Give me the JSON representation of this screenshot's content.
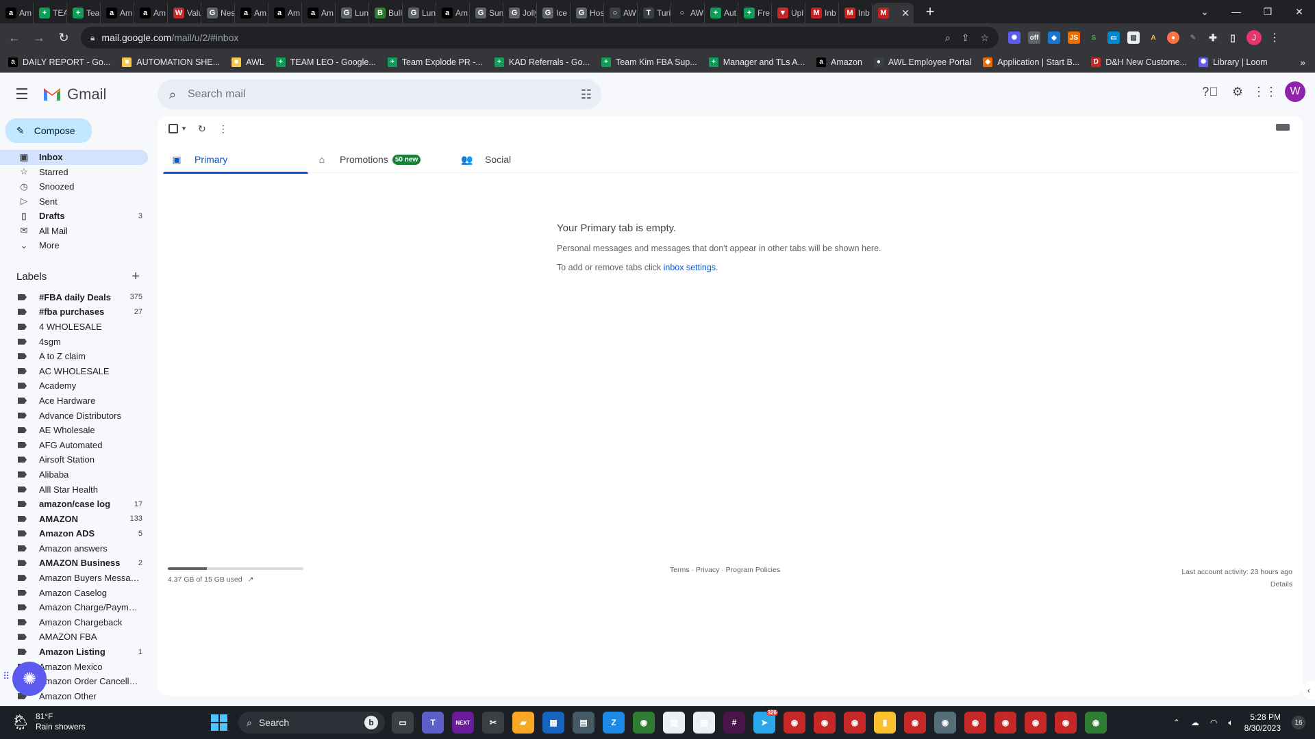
{
  "browser": {
    "tabs": [
      {
        "label": "Am",
        "icon": "a",
        "color": "#000000"
      },
      {
        "label": "TEA",
        "icon": "+",
        "color": "#0f9d58"
      },
      {
        "label": "Tea",
        "icon": "+",
        "color": "#0f9d58"
      },
      {
        "label": "Am",
        "icon": "a",
        "color": "#000000"
      },
      {
        "label": "Am",
        "icon": "a",
        "color": "#000000"
      },
      {
        "label": "Valu",
        "icon": "W",
        "color": "#c62828"
      },
      {
        "label": "Nes",
        "icon": "G",
        "color": "#5f6368"
      },
      {
        "label": "Am",
        "icon": "a",
        "color": "#000000"
      },
      {
        "label": "Am",
        "icon": "a",
        "color": "#000000"
      },
      {
        "label": "Am",
        "icon": "a",
        "color": "#000000"
      },
      {
        "label": "Lun",
        "icon": "G",
        "color": "#5f6368"
      },
      {
        "label": "Bull",
        "icon": "B",
        "color": "#2e7d32"
      },
      {
        "label": "Lun",
        "icon": "G",
        "color": "#5f6368"
      },
      {
        "label": "Am",
        "icon": "a",
        "color": "#000000"
      },
      {
        "label": "Sun",
        "icon": "G",
        "color": "#5f6368"
      },
      {
        "label": "Jolly",
        "icon": "G",
        "color": "#5f6368"
      },
      {
        "label": "Ice I",
        "icon": "G",
        "color": "#5f6368"
      },
      {
        "label": "Hos",
        "icon": "G",
        "color": "#5f6368"
      },
      {
        "label": "AWI",
        "icon": "○",
        "color": "#3c4043"
      },
      {
        "label": "Turi",
        "icon": "T",
        "color": "#3c4043"
      },
      {
        "label": "AWI",
        "icon": "○",
        "color": "#202124"
      },
      {
        "label": "Aut",
        "icon": "+",
        "color": "#0f9d58"
      },
      {
        "label": "Fre",
        "icon": "+",
        "color": "#0f9d58"
      },
      {
        "label": "Upl",
        "icon": "▼",
        "color": "#c62828"
      },
      {
        "label": "Inb",
        "icon": "M",
        "color": "#c5221f"
      },
      {
        "label": "Inb",
        "icon": "M",
        "color": "#c5221f"
      }
    ],
    "active_tab": {
      "label": "",
      "icon": "M",
      "color": "#c5221f"
    },
    "url_host": "mail.google.com",
    "url_path": "/mail/u/2/#inbox",
    "profile_initial": "J",
    "bookmarks": [
      {
        "label": "DAILY REPORT - Go...",
        "icon": "a",
        "color": "#000000"
      },
      {
        "label": "AUTOMATION SHE...",
        "icon": "■",
        "color": "#f9c74f"
      },
      {
        "label": "AWL",
        "icon": "■",
        "color": "#f9c74f"
      },
      {
        "label": "TEAM LEO - Google...",
        "icon": "+",
        "color": "#0f9d58"
      },
      {
        "label": "Team Explode PR -...",
        "icon": "+",
        "color": "#0f9d58"
      },
      {
        "label": "KAD Referrals - Go...",
        "icon": "+",
        "color": "#0f9d58"
      },
      {
        "label": "Team Kim FBA Sup...",
        "icon": "+",
        "color": "#0f9d58"
      },
      {
        "label": "Manager and TLs A...",
        "icon": "+",
        "color": "#0f9d58"
      },
      {
        "label": "Amazon",
        "icon": "a",
        "color": "#000000"
      },
      {
        "label": "AWL Employee Portal",
        "icon": "●",
        "color": "#3c4043"
      },
      {
        "label": "Application | Start B...",
        "icon": "◆",
        "color": "#ef6c00"
      },
      {
        "label": "D&H New Custome...",
        "icon": "D",
        "color": "#c62828"
      },
      {
        "label": "Library | Loom",
        "icon": "✺",
        "color": "#625df5"
      }
    ]
  },
  "gmail": {
    "product_name": "Gmail",
    "search_placeholder": "Search mail",
    "avatar_initial": "W",
    "compose_label": "Compose",
    "nav": [
      {
        "label": "Inbox",
        "icon": "▣",
        "count": "",
        "active": true,
        "bold": true
      },
      {
        "label": "Starred",
        "icon": "☆",
        "count": "",
        "active": false,
        "bold": false
      },
      {
        "label": "Snoozed",
        "icon": "◷",
        "count": "",
        "active": false,
        "bold": false
      },
      {
        "label": "Sent",
        "icon": "▷",
        "count": "",
        "active": false,
        "bold": false
      },
      {
        "label": "Drafts",
        "icon": "▯",
        "count": "3",
        "active": false,
        "bold": true
      },
      {
        "label": "All Mail",
        "icon": "✉",
        "count": "",
        "active": false,
        "bold": false
      },
      {
        "label": "More",
        "icon": "⌄",
        "count": "",
        "active": false,
        "bold": false
      }
    ],
    "labels_title": "Labels",
    "labels": [
      {
        "name": "#FBA daily Deals",
        "count": "375",
        "bold": true
      },
      {
        "name": "#fba purchases",
        "count": "27",
        "bold": true
      },
      {
        "name": "4 WHOLESALE",
        "count": "",
        "bold": false
      },
      {
        "name": "4sgm",
        "count": "",
        "bold": false
      },
      {
        "name": "A to Z claim",
        "count": "",
        "bold": false
      },
      {
        "name": "AC WHOLESALE",
        "count": "",
        "bold": false
      },
      {
        "name": "Academy",
        "count": "",
        "bold": false
      },
      {
        "name": "Ace Hardware",
        "count": "",
        "bold": false
      },
      {
        "name": "Advance Distributors",
        "count": "",
        "bold": false
      },
      {
        "name": "AE Wholesale",
        "count": "",
        "bold": false
      },
      {
        "name": "AFG Automated",
        "count": "",
        "bold": false
      },
      {
        "name": "Airsoft Station",
        "count": "",
        "bold": false
      },
      {
        "name": "Alibaba",
        "count": "",
        "bold": false
      },
      {
        "name": "Alll Star Health",
        "count": "",
        "bold": false
      },
      {
        "name": "amazon/case log",
        "count": "17",
        "bold": true
      },
      {
        "name": "AMAZON",
        "count": "133",
        "bold": true
      },
      {
        "name": "Amazon ADS",
        "count": "5",
        "bold": true
      },
      {
        "name": "Amazon answers",
        "count": "",
        "bold": false
      },
      {
        "name": "AMAZON Business",
        "count": "2",
        "bold": true
      },
      {
        "name": "Amazon Buyers Messages",
        "count": "",
        "bold": false
      },
      {
        "name": "Amazon Caselog",
        "count": "",
        "bold": false
      },
      {
        "name": "Amazon Charge/Paymen...",
        "count": "",
        "bold": false
      },
      {
        "name": "Amazon Chargeback",
        "count": "",
        "bold": false
      },
      {
        "name": "AMAZON FBA",
        "count": "",
        "bold": false
      },
      {
        "name": "Amazon Listing",
        "count": "1",
        "bold": true
      },
      {
        "name": "Amazon Mexico",
        "count": "",
        "bold": false
      },
      {
        "name": "Amazon Order Cancellat...",
        "count": "",
        "bold": false
      },
      {
        "name": "Amazon Other",
        "count": "",
        "bold": false
      }
    ],
    "tabs": [
      {
        "label": "Primary",
        "icon": "▣",
        "badge": "",
        "active": true
      },
      {
        "label": "Promotions",
        "icon": "⌂",
        "badge": "50 new",
        "active": false
      },
      {
        "label": "Social",
        "icon": "👥",
        "badge": "",
        "active": false
      }
    ],
    "empty_title": "Your Primary tab is empty.",
    "empty_desc": "Personal messages and messages that don't appear in other tabs will be shown here.",
    "empty_tabs_prefix": "To add or remove tabs click ",
    "empty_tabs_link": "inbox settings",
    "empty_tabs_suffix": ".",
    "storage_text": "4.37 GB of 15 GB used",
    "storage_fraction": 0.29,
    "footer_links": "Terms · Privacy · Program Policies",
    "last_activity": "Last account activity: 23 hours ago",
    "details_link": "Details"
  },
  "taskbar": {
    "temperature": "81°F",
    "weather": "Rain showers",
    "search_label": "Search",
    "time": "5:28 PM",
    "date": "8/30/2023",
    "notification_count": "16",
    "apps": [
      {
        "name": "task-view-app",
        "glyph": "▭",
        "color": "#3c4043",
        "badge": ""
      },
      {
        "name": "teams-app",
        "glyph": "T",
        "color": "#5b5fc7",
        "badge": ""
      },
      {
        "name": "next-app",
        "glyph": "NEXT",
        "color": "#6a1b9a",
        "badge": ""
      },
      {
        "name": "snip-app",
        "glyph": "✂",
        "color": "#3c4043",
        "badge": ""
      },
      {
        "name": "explorer-app",
        "glyph": "▰",
        "color": "#f9a825",
        "badge": ""
      },
      {
        "name": "calendar-app",
        "glyph": "▦",
        "color": "#1565c0",
        "badge": ""
      },
      {
        "name": "calculator-app",
        "glyph": "▤",
        "color": "#455a64",
        "badge": ""
      },
      {
        "name": "zoom-app",
        "glyph": "Z",
        "color": "#1e88e5",
        "badge": ""
      },
      {
        "name": "chrome-app-1",
        "glyph": "◉",
        "color": "#2e7d32",
        "badge": ""
      },
      {
        "name": "chart-app-1",
        "glyph": "▥",
        "color": "#eceff1",
        "badge": ""
      },
      {
        "name": "chart-app-2",
        "glyph": "▥",
        "color": "#eceff1",
        "badge": ""
      },
      {
        "name": "slack-app",
        "glyph": "#",
        "color": "#4a154b",
        "badge": ""
      },
      {
        "name": "telegram-app",
        "glyph": "➤",
        "color": "#29a9eb",
        "badge": "326"
      },
      {
        "name": "chrome-app-2",
        "glyph": "◉",
        "color": "#c62828",
        "badge": ""
      },
      {
        "name": "chrome-app-3",
        "glyph": "◉",
        "color": "#c62828",
        "badge": ""
      },
      {
        "name": "chrome-app-4",
        "glyph": "◉",
        "color": "#c62828",
        "badge": ""
      },
      {
        "name": "sticky-notes-app",
        "glyph": "▮",
        "color": "#fbc02d",
        "badge": ""
      },
      {
        "name": "chrome-app-5",
        "glyph": "◉",
        "color": "#c62828",
        "badge": ""
      },
      {
        "name": "chrome-app-6",
        "glyph": "◉",
        "color": "#546e7a",
        "badge": ""
      },
      {
        "name": "chrome-app-7",
        "glyph": "◉",
        "color": "#c62828",
        "badge": ""
      },
      {
        "name": "chrome-app-8",
        "glyph": "◉",
        "color": "#c62828",
        "badge": ""
      },
      {
        "name": "chrome-app-9",
        "glyph": "◉",
        "color": "#c62828",
        "badge": ""
      },
      {
        "name": "chrome-app-10",
        "glyph": "◉",
        "color": "#c62828",
        "badge": ""
      },
      {
        "name": "chrome-app-11",
        "glyph": "◉",
        "color": "#2e7d32",
        "badge": ""
      }
    ]
  }
}
